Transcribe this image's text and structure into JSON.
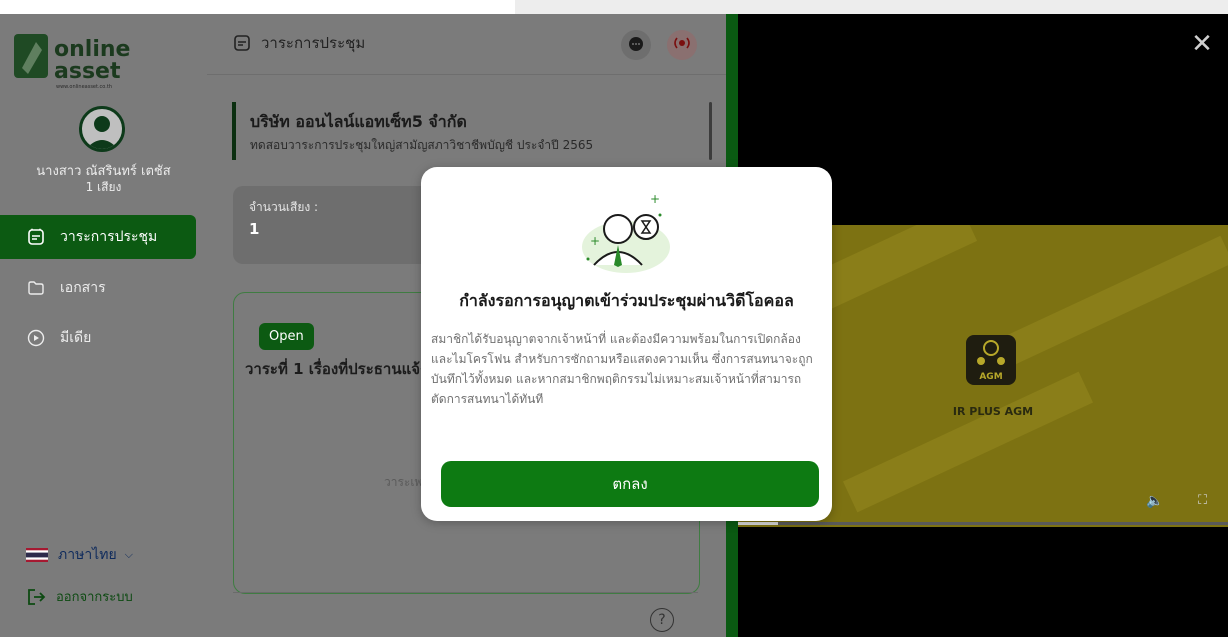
{
  "brand": {
    "logo_word1": "online",
    "logo_word2": "asset",
    "logo_url_text": "www.onlineasset.co.th"
  },
  "user": {
    "name": "นางสาว ณัสรินทร์ เตชัส",
    "votes": "1 เสียง"
  },
  "sidebar": {
    "items": [
      {
        "label": "วาระการประชุม",
        "active": true,
        "icon": "agenda-icon"
      },
      {
        "label": "เอกสาร",
        "active": false,
        "icon": "folder-icon"
      },
      {
        "label": "มีเดีย",
        "active": false,
        "icon": "play-icon"
      }
    ],
    "language": "ภาษาไทย",
    "logout": "ออกจากระบบ"
  },
  "header": {
    "title": "วาระการประชุม"
  },
  "company": {
    "name": "บริษัท ออนไลน์แอทเซ็ท5 จำกัด",
    "subtitle": "ทดสอบวาระการประชุมใหญ่สามัญสภาวิชาชีพบัญชี ประจำปี 2565"
  },
  "votes": {
    "label": "จำนวนเสียง :",
    "value": "1"
  },
  "agenda": {
    "status": "Open",
    "title": "วาระที่ 1 เรื่องที่ประธานแจ้ง",
    "hint": "วาระเพ"
  },
  "video": {
    "logo_text": "IR PLUS AGM"
  },
  "modal": {
    "title": "กำลังรอการอนุญาตเข้าร่วมประชุมผ่านวิดีโอคอล",
    "body_lines": [
      "สมาชิกได้รับอนุญาตจากเจ้าหน้าที่ และต้องมีความพร้อมในการเปิดกล้อง",
      "และไมโครโฟน สำหรับการซักถามหรือแสดงความเห็น ซึ่งการสนทนาจะถูก",
      "บันทึกไว้ทั้งหมด และหากสมาชิกพฤติกรรมไม่เหมาะสมเจ้าหน้าที่สามารถ",
      "ตัดการสนทนาได้ทันที"
    ],
    "button": "ตกลง"
  },
  "colors": {
    "primary_green": "#0d7a12",
    "overlay_gray": "#7b7b7b",
    "video_bg": "#7d7212"
  }
}
